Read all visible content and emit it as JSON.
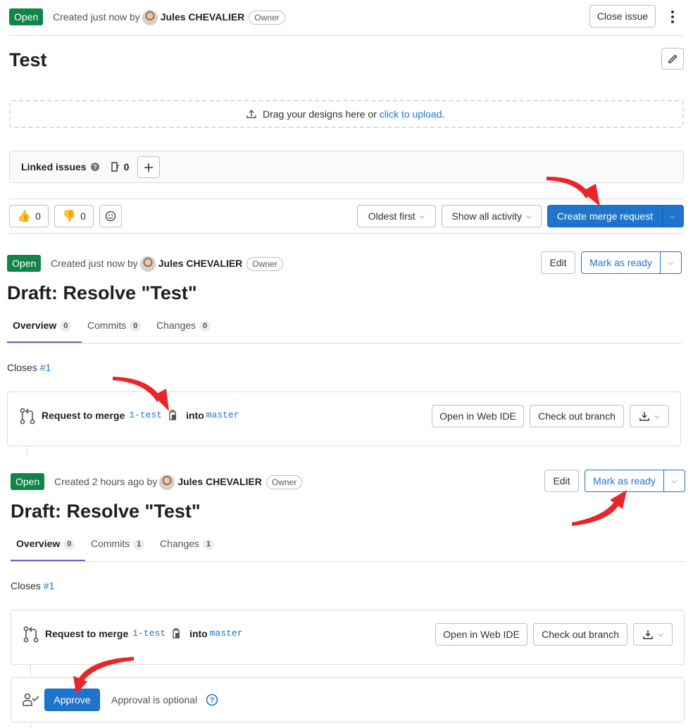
{
  "issue": {
    "status": "Open",
    "created_text": "Created just now by",
    "author": "Jules CHEVALIER",
    "role": "Owner",
    "close_button": "Close issue",
    "title": "Test",
    "upload_text": "Drag your designs here or",
    "upload_link": "click to upload",
    "upload_period": ".",
    "linked_issues_label": "Linked issues",
    "linked_issues_count": "0",
    "thumbs_up_count": "0",
    "thumbs_down_count": "0",
    "sort_label": "Oldest first",
    "activity_label": "Show all activity",
    "create_mr_label": "Create merge request"
  },
  "mr1": {
    "status": "Open",
    "created_text": "Created just now by",
    "author": "Jules CHEVALIER",
    "role": "Owner",
    "edit_label": "Edit",
    "mark_ready_label": "Mark as ready",
    "title": "Draft: Resolve \"Test\"",
    "tabs": [
      {
        "label": "Overview",
        "count": "0"
      },
      {
        "label": "Commits",
        "count": "0"
      },
      {
        "label": "Changes",
        "count": "0"
      }
    ],
    "closes_label": "Closes",
    "closes_ref": "#1",
    "request_label": "Request to merge",
    "source_branch": "1-test",
    "into_label": "into",
    "target_branch": "master",
    "web_ide_label": "Open in Web IDE",
    "checkout_label": "Check out branch"
  },
  "mr2": {
    "status": "Open",
    "created_text": "Created 2 hours ago by",
    "author": "Jules CHEVALIER",
    "role": "Owner",
    "edit_label": "Edit",
    "mark_ready_label": "Mark as ready",
    "title": "Draft: Resolve \"Test\"",
    "tabs": [
      {
        "label": "Overview",
        "count": "0"
      },
      {
        "label": "Commits",
        "count": "1"
      },
      {
        "label": "Changes",
        "count": "1"
      }
    ],
    "closes_label": "Closes",
    "closes_ref": "#1",
    "request_label": "Request to merge",
    "source_branch": "1-test",
    "into_label": "into",
    "target_branch": "master",
    "web_ide_label": "Open in Web IDE",
    "checkout_label": "Check out branch",
    "approve_label": "Approve",
    "approval_text": "Approval is optional"
  },
  "colors": {
    "open_green": "#108548",
    "link_blue": "#1f75cb",
    "arrow_red": "#e8262a"
  },
  "icons": [
    "kebab-menu-icon",
    "pencil-icon",
    "upload-icon",
    "question-icon",
    "issues-icon",
    "plus-icon",
    "thumbs-up-icon",
    "thumbs-down-icon",
    "smiley-icon",
    "chevron-down-icon",
    "merge-request-icon",
    "copy-icon",
    "download-icon",
    "approval-icon",
    "help-circle-icon"
  ]
}
